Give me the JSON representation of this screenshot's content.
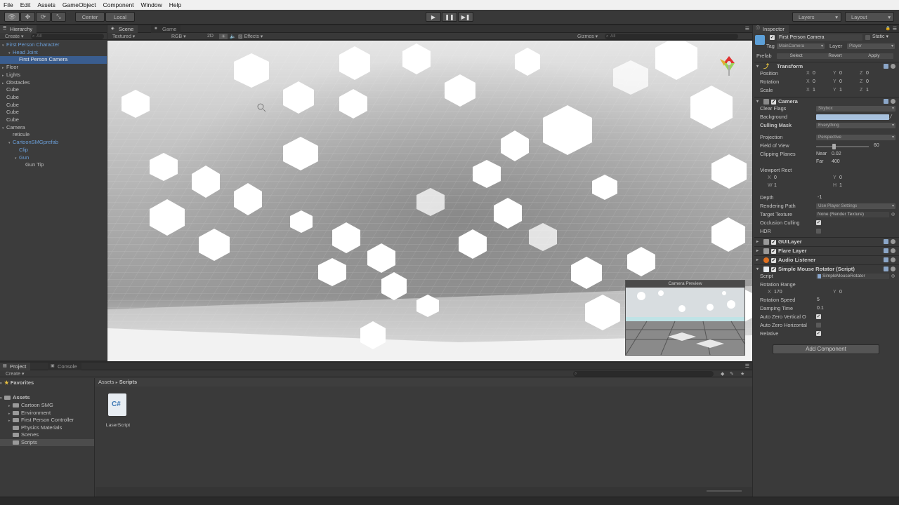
{
  "menu": [
    "File",
    "Edit",
    "Assets",
    "GameObject",
    "Component",
    "Window",
    "Help"
  ],
  "toolbar": {
    "pivot": "Center",
    "space": "Local",
    "layers": "Layers",
    "layout": "Layout"
  },
  "hierarchy": {
    "tab": "Hierarchy",
    "create": "Create",
    "search": "All",
    "items": [
      {
        "label": "First Person Character",
        "indent": 0,
        "arrow": "▾",
        "style": "blue"
      },
      {
        "label": "Head Joint",
        "indent": 1,
        "arrow": "▾",
        "style": "blue"
      },
      {
        "label": "First Person Camera",
        "indent": 2,
        "arrow": "",
        "style": "sel"
      },
      {
        "label": "Floor",
        "indent": 0,
        "arrow": "▸",
        "style": ""
      },
      {
        "label": "Lights",
        "indent": 0,
        "arrow": "▸",
        "style": ""
      },
      {
        "label": "Obstacles",
        "indent": 0,
        "arrow": "▸",
        "style": ""
      },
      {
        "label": "Cube",
        "indent": 0,
        "arrow": "",
        "style": ""
      },
      {
        "label": "Cube",
        "indent": 0,
        "arrow": "",
        "style": ""
      },
      {
        "label": "Cube",
        "indent": 0,
        "arrow": "",
        "style": ""
      },
      {
        "label": "Cube",
        "indent": 0,
        "arrow": "",
        "style": ""
      },
      {
        "label": "Cube",
        "indent": 0,
        "arrow": "",
        "style": ""
      },
      {
        "label": "Camera",
        "indent": 0,
        "arrow": "▾",
        "style": ""
      },
      {
        "label": "reticule",
        "indent": 1,
        "arrow": "",
        "style": ""
      },
      {
        "label": "CartoonSMGprefab",
        "indent": 1,
        "arrow": "▾",
        "style": "blue"
      },
      {
        "label": "Clip",
        "indent": 2,
        "arrow": "",
        "style": "blue"
      },
      {
        "label": "Gun",
        "indent": 2,
        "arrow": "▾",
        "style": "blue"
      },
      {
        "label": "Gun Tip",
        "indent": 3,
        "arrow": "",
        "style": ""
      }
    ]
  },
  "scene": {
    "tab_scene": "Scene",
    "tab_game": "Game",
    "shading": "Textured",
    "render": "RGB",
    "mode2d": "2D",
    "effects": "Effects",
    "gizmos": "Gizmos",
    "search": "All",
    "preview_title": "Camera Preview"
  },
  "project": {
    "tab_project": "Project",
    "tab_console": "Console",
    "create": "Create",
    "favorites": "Favorites",
    "assets": "Assets",
    "folders": [
      "Cartoon SMG",
      "Environment",
      "First Person Controller",
      "Physics Materials",
      "Scenes",
      "Scripts"
    ],
    "selected_folder": "Scripts",
    "breadcrumb": [
      "Assets",
      "Scripts"
    ],
    "breadcrumb_sep": "▸",
    "asset_name": "LaserScript",
    "asset_glyph": "C#"
  },
  "inspector": {
    "tab": "Inspector",
    "object_name": "First Person Camera",
    "static": "Static",
    "tag_label": "Tag",
    "tag_value": "MainCamera",
    "layer_label": "Layer",
    "layer_value": "Player",
    "prefab_label": "Prefab",
    "prefab_select": "Select",
    "prefab_revert": "Revert",
    "prefab_apply": "Apply",
    "transform": {
      "title": "Transform",
      "position_label": "Position",
      "rotation_label": "Rotation",
      "scale_label": "Scale",
      "position": [
        "0",
        "0",
        "0"
      ],
      "rotation": [
        "0",
        "0",
        "0"
      ],
      "scale": [
        "1",
        "1",
        "1"
      ],
      "axes": [
        "X",
        "Y",
        "Z"
      ]
    },
    "camera": {
      "title": "Camera",
      "clear_flags_label": "Clear Flags",
      "clear_flags": "Skybox",
      "background_label": "Background",
      "culling_label": "Culling Mask",
      "culling": "Everything",
      "projection_label": "Projection",
      "projection": "Perspective",
      "fov_label": "Field of View",
      "fov": "60",
      "fov_fraction": 0.33,
      "clipping_label": "Clipping Planes",
      "near_label": "Near",
      "near": "0.02",
      "far_label": "Far",
      "far": "400",
      "viewport_label": "Viewport Rect",
      "vp_x": "0",
      "vp_y": "0",
      "vp_w": "1",
      "vp_h": "1",
      "depth_label": "Depth",
      "depth": "-1",
      "rendering_label": "Rendering Path",
      "rendering": "Use Player Settings",
      "target_label": "Target Texture",
      "target": "None (Render Texture)",
      "occlusion_label": "Occlusion Culling",
      "hdr_label": "HDR",
      "background_color": "#a8c2de"
    },
    "components": [
      "GUILayer",
      "Flare Layer",
      "Audio Listener"
    ],
    "script_comp": {
      "title": "Simple Mouse Rotator (Script)",
      "script_label": "Script",
      "script_value": "SimpleMouseRotator",
      "range_label": "Rotation Range",
      "range_x": "170",
      "range_y": "0",
      "speed_label": "Rotation Speed",
      "speed": "5",
      "damping_label": "Damping Time",
      "damping": "0.1",
      "azv_label": "Auto Zero Vertical O",
      "azh_label": "Auto Zero Horizontal",
      "relative_label": "Relative"
    },
    "add_component": "Add Component"
  },
  "colors": {
    "accent": "#3a5d8f",
    "link": "#6b9fd9"
  }
}
